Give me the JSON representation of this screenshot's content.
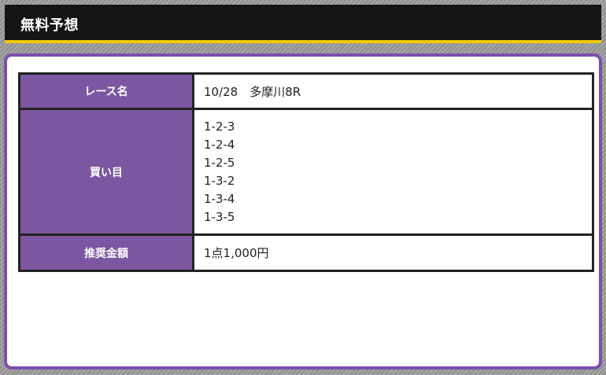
{
  "header": {
    "title": "無料予想"
  },
  "table": {
    "race_label": "レース名",
    "race_value": "10/28　多摩川8R",
    "buy_label": "買い目",
    "picks": [
      "1-2-3",
      "1-2-4",
      "1-2-5",
      "1-3-2",
      "1-3-4",
      "1-3-5"
    ],
    "amount_label": "推奨金額",
    "amount_value": "1点1,000円"
  },
  "colors": {
    "header_bg": "#141414",
    "header_accent": "#f0c800",
    "panel_border": "#7b50b0",
    "label_bg": "#7a57a0"
  }
}
